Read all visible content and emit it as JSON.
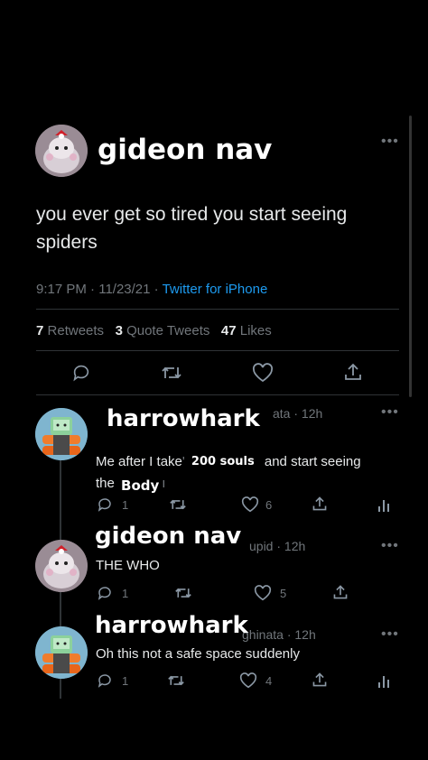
{
  "main_tweet": {
    "author": "gideon nav",
    "text": "you ever get so tired you start seeing spiders",
    "time": "9:17 PM",
    "date": "11/23/21",
    "source": "Twitter for iPhone",
    "retweets": "7",
    "retweets_label": "Retweets",
    "quotes": "3",
    "quotes_label": "Quote Tweets",
    "likes": "47",
    "likes_label": "Likes"
  },
  "replies": [
    {
      "author": "harrowhark",
      "handle_suffix": "ata",
      "time": "12h",
      "text_line1": "Me after I take",
      "sticker1": "200 souls",
      "text_line1b": "and start seeing",
      "text_line2": "the",
      "sticker2": "Body",
      "reply_count": "1",
      "like_count": "6"
    },
    {
      "author": "gideon nav",
      "handle_suffix": "upid",
      "time": "12h",
      "text": "THE WHO",
      "reply_count": "1",
      "like_count": "5"
    },
    {
      "author": "harrowhark",
      "handle_suffix": "ghinata",
      "time": "12h",
      "text": "Oh this not a safe space suddenly",
      "reply_count": "1",
      "like_count": "4"
    }
  ],
  "icons": {
    "reply": "reply-icon",
    "retweet": "retweet-icon",
    "like": "heart-icon",
    "share": "share-icon",
    "analytics": "analytics-icon",
    "more": "more-icon"
  },
  "colors": {
    "background": "#000000",
    "link": "#1d9bf0",
    "muted": "#71767b"
  }
}
